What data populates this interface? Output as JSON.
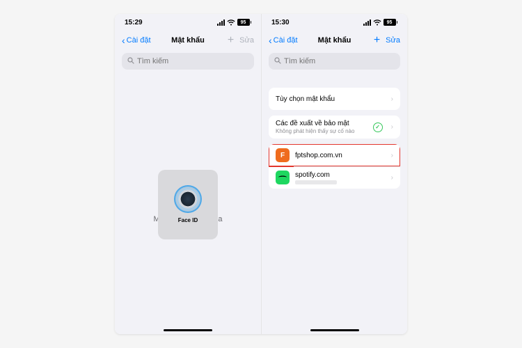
{
  "left": {
    "time": "15:29",
    "battery": "95",
    "back_label": "Cài đặt",
    "title": "Mật khẩu",
    "edit_label": "Sửa",
    "search_placeholder": "Tìm kiếm",
    "locked_text": "Mật khẩu đã bị khóa",
    "faceid_label": "Face ID"
  },
  "right": {
    "time": "15:30",
    "battery": "95",
    "back_label": "Cài đặt",
    "title": "Mật khẩu",
    "edit_label": "Sửa",
    "search_placeholder": "Tìm kiếm",
    "options_label": "Tùy chọn mật khẩu",
    "security_title": "Các đề xuất về bảo mật",
    "security_sub": "Không phát hiện thấy sự cố nào",
    "accounts": [
      {
        "site": "fptshop.com.vn",
        "icon_letter": "F",
        "icon_color": "orange",
        "highlighted": true
      },
      {
        "site": "spotify.com",
        "icon_letter": "",
        "icon_color": "spotify",
        "highlighted": false
      }
    ]
  }
}
